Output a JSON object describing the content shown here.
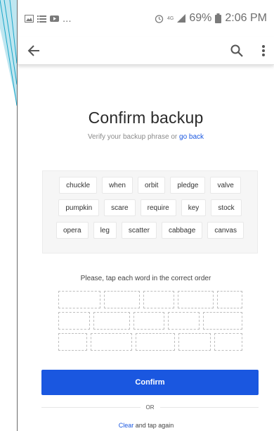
{
  "status_bar": {
    "more": "...",
    "network": "4G",
    "battery_pct": "69%",
    "time": "2:06 PM"
  },
  "app_bar": {
    "back_icon": "arrow-left-icon",
    "search_icon": "search-icon",
    "menu_icon": "more-vertical-icon"
  },
  "page": {
    "title": "Confirm backup",
    "subtitle_prefix": "Verify your backup phrase or ",
    "subtitle_link": "go back"
  },
  "words": {
    "row1": [
      "chuckle",
      "when",
      "orbit",
      "pledge",
      "valve"
    ],
    "row2": [
      "pumpkin",
      "scare",
      "require",
      "key",
      "stock"
    ],
    "row3": [
      "opera",
      "leg",
      "scatter",
      "cabbage",
      "canvas"
    ]
  },
  "instruction": "Please, tap each word in the correct order",
  "actions": {
    "confirm_label": "Confirm",
    "or_label": "OR",
    "clear_link": "Clear",
    "clear_suffix": " and tap again"
  },
  "colors": {
    "accent": "#1a57e0",
    "frame_teal": "#1aa6c8"
  }
}
